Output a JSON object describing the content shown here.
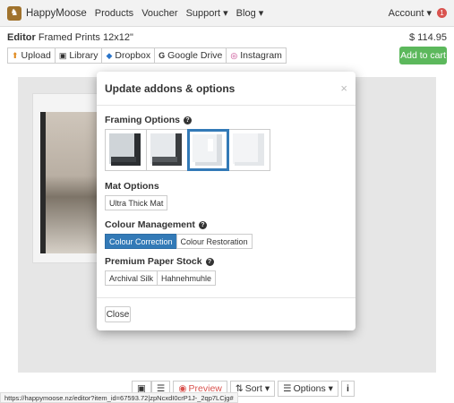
{
  "nav": {
    "brand": "HappyMoose",
    "links": [
      "Products",
      "Voucher",
      "Support ▾",
      "Blog ▾"
    ],
    "account": "Account ▾",
    "notification_count": "1"
  },
  "editor": {
    "label": "Editor",
    "product": "Framed Prints 12x12\"",
    "price": "$ 114.95"
  },
  "toolbar": {
    "upload": "Upload",
    "library": "Library",
    "dropbox": "Dropbox",
    "google_drive": "Google Drive",
    "instagram": "Instagram",
    "add_to_cart": "Add to cart"
  },
  "modal": {
    "title": "Update addons & options",
    "close_symbol": "×",
    "framing": {
      "label": "Framing Options",
      "options": [
        "black-frame",
        "dark-grey-frame",
        "white-frame",
        "light-white-frame"
      ],
      "selected_index": 2
    },
    "mat": {
      "label": "Mat Options",
      "options": [
        "Ultra Thick Mat"
      ]
    },
    "colour": {
      "label": "Colour Management",
      "options": [
        "Colour Correction",
        "Colour Restoration"
      ],
      "selected": "Colour Correction"
    },
    "paper": {
      "label": "Premium Paper Stock",
      "options": [
        "Archival Silk",
        "Hahnehmuhle"
      ]
    },
    "close_button": "Close"
  },
  "bottom_bar": {
    "preview": "Preview",
    "sort": "Sort ▾",
    "options": "Options ▾",
    "info": "i"
  },
  "status_url": "https://happymoose.nz/editor?item_id=67593.72|zpNcxdI0crP1J-_2qp7LCjg#",
  "colors": {
    "accent": "#337ab7",
    "success": "#5cb85c",
    "badge": "#d9534f"
  }
}
